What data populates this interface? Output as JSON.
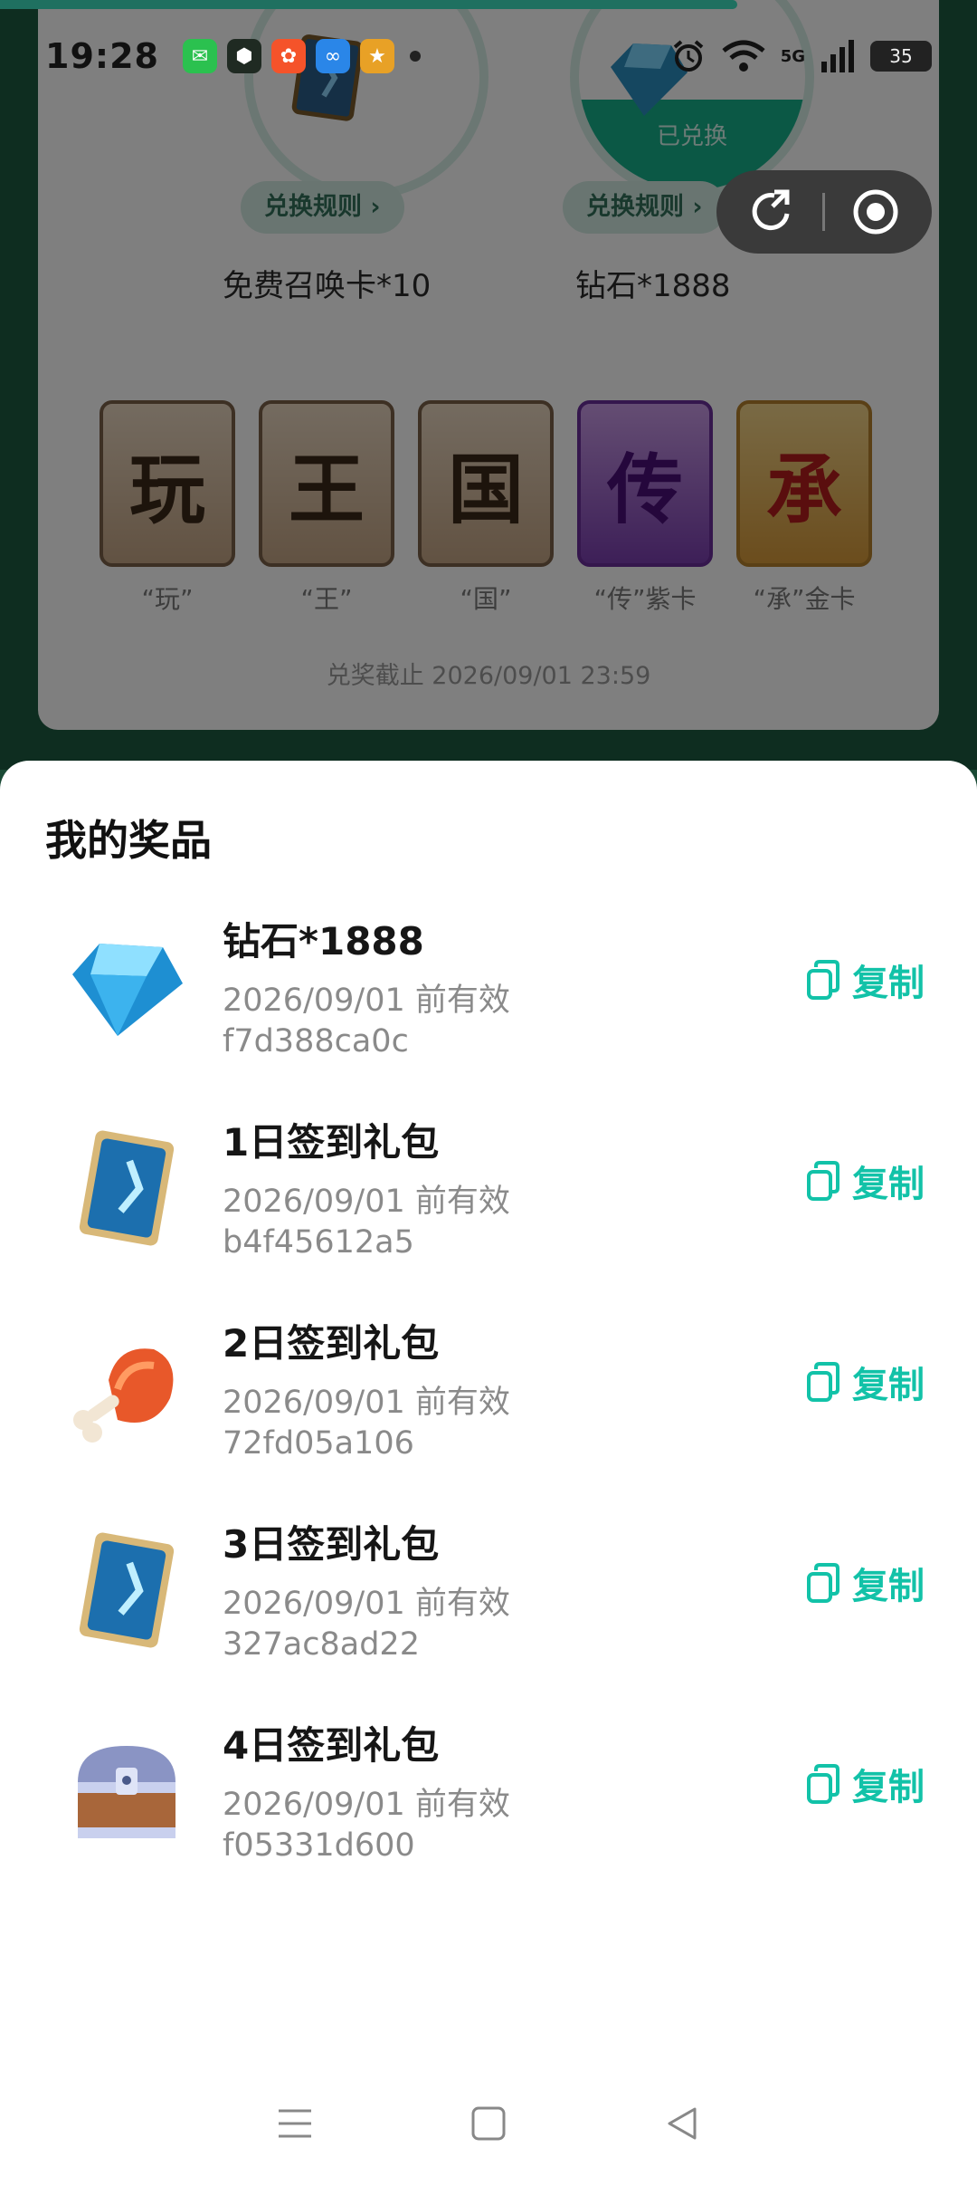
{
  "status_bar": {
    "time": "19:28",
    "battery": "35",
    "network": "5G"
  },
  "background": {
    "prizes": [
      {
        "name": "免费召唤卡*10",
        "rule_label": "兑换规则 ›"
      },
      {
        "name": "钻石*1888",
        "rule_label": "兑换规则 ›",
        "claimed_label": "已兑换"
      }
    ],
    "tiles": [
      {
        "char": "玩",
        "label": "“玩”"
      },
      {
        "char": "王",
        "label": "“王”"
      },
      {
        "char": "国",
        "label": "“国”"
      },
      {
        "char": "传",
        "label": "“传”紫卡"
      },
      {
        "char": "承",
        "label": "“承”金卡"
      }
    ],
    "deadline": "兑奖截止 2026/09/01 23:59"
  },
  "sheet": {
    "title": "我的奖品",
    "copy_label": "复制",
    "items": [
      {
        "name": "钻石*1888",
        "valid": "2026/09/01 前有效",
        "code": "f7d388ca0c",
        "icon": "diamond-icon"
      },
      {
        "name": "1日签到礼包",
        "valid": "2026/09/01 前有效",
        "code": "b4f45612a5",
        "icon": "summon-card-icon"
      },
      {
        "name": "2日签到礼包",
        "valid": "2026/09/01 前有效",
        "code": "72fd05a106",
        "icon": "meat-icon"
      },
      {
        "name": "3日签到礼包",
        "valid": "2026/09/01 前有效",
        "code": "327ac8ad22",
        "icon": "summon-card-icon"
      },
      {
        "name": "4日签到礼包",
        "valid": "2026/09/01 前有效",
        "code": "f05331d600",
        "icon": "treasure-chest-icon"
      }
    ]
  },
  "colors": {
    "accent": "#12c2a8",
    "page_bg": "#1d5a40"
  }
}
